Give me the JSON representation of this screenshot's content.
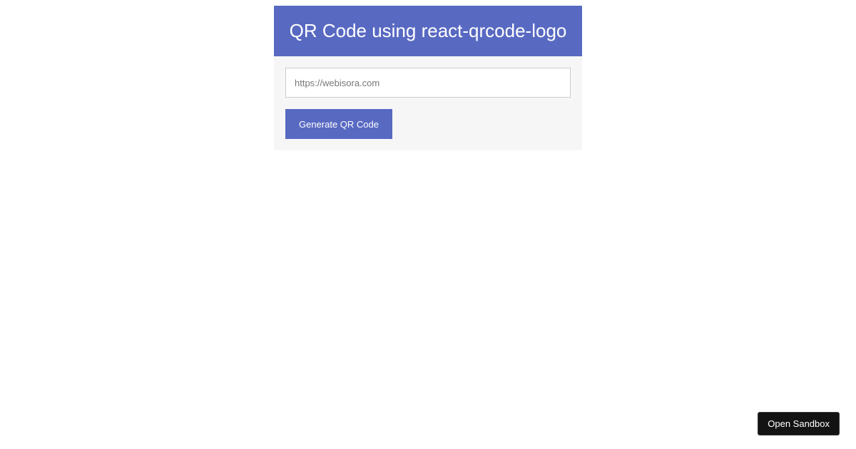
{
  "header": {
    "title": "QR Code using react-qrcode-logo"
  },
  "form": {
    "url_input": {
      "value": "",
      "placeholder": "https://webisora.com"
    },
    "generate_label": "Generate QR Code"
  },
  "sandbox": {
    "open_label": "Open Sandbox"
  },
  "colors": {
    "accent": "#5869c2",
    "card_background": "#f6f6f6",
    "sandbox_button": "#131313"
  }
}
